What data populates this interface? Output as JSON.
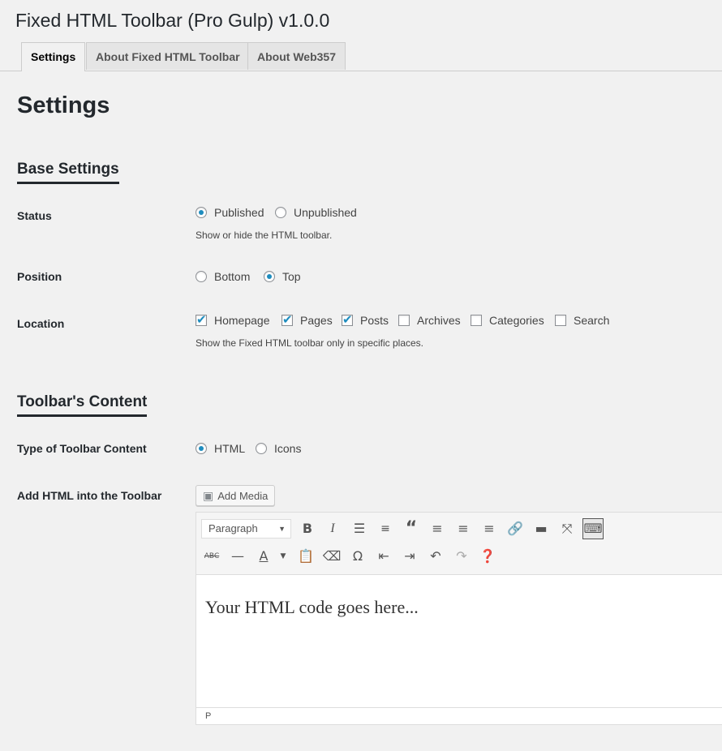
{
  "header": {
    "title": "Fixed HTML Toolbar (Pro Gulp) v1.0.0"
  },
  "tabs": [
    {
      "label": "Settings",
      "active": true
    },
    {
      "label": "About Fixed HTML Toolbar",
      "active": false
    },
    {
      "label": "About Web357",
      "active": false
    }
  ],
  "page": {
    "heading": "Settings"
  },
  "base_settings": {
    "title": "Base Settings",
    "status": {
      "label": "Status",
      "options": [
        "Published",
        "Unpublished"
      ],
      "selected": "Published",
      "description": "Show or hide the HTML toolbar."
    },
    "position": {
      "label": "Position",
      "options": [
        "Bottom",
        "Top"
      ],
      "selected": "Top"
    },
    "location": {
      "label": "Location",
      "options": [
        "Homepage",
        "Pages",
        "Posts",
        "Archives",
        "Categories",
        "Search"
      ],
      "checked": [
        "Homepage",
        "Pages",
        "Posts"
      ],
      "description": "Show the Fixed HTML toolbar only in specific places."
    }
  },
  "toolbar_content": {
    "title": "Toolbar's Content",
    "type": {
      "label": "Type of Toolbar Content",
      "options": [
        "HTML",
        "Icons"
      ],
      "selected": "HTML"
    },
    "html": {
      "label": "Add HTML into the Toolbar",
      "add_media_label": "Add Media",
      "format_select": "Paragraph",
      "content": "Your HTML code goes here...",
      "status_path": "P"
    }
  },
  "colors": {
    "accent": "#1e8cbe",
    "text": "#23282d",
    "background": "#f1f1f1"
  },
  "icons": {
    "row1": [
      "bold-icon",
      "italic-icon",
      "bullet-list-icon",
      "numbered-list-icon",
      "blockquote-icon",
      "align-left-icon",
      "align-center-icon",
      "align-right-icon",
      "link-icon",
      "read-more-icon",
      "fullscreen-icon",
      "toolbar-toggle-icon"
    ],
    "row2": [
      "strikethrough-icon",
      "horizontal-line-icon",
      "text-color-icon",
      "paste-text-icon",
      "clear-formatting-icon",
      "special-character-icon",
      "outdent-icon",
      "indent-icon",
      "undo-icon",
      "redo-icon",
      "help-icon"
    ]
  }
}
